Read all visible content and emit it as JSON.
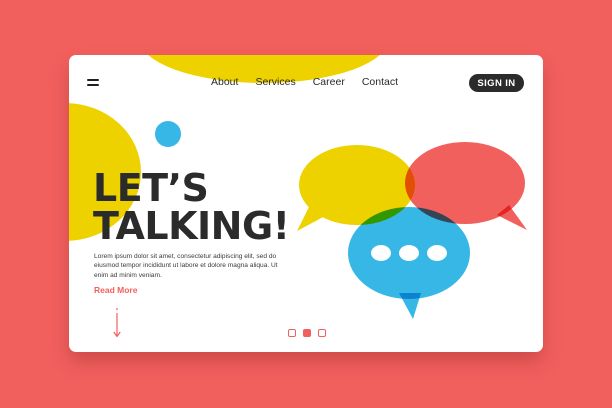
{
  "nav": {
    "items": [
      "About",
      "Services",
      "Career",
      "Contact"
    ],
    "signin_label": "SIGN IN"
  },
  "hero": {
    "headline_line1": "LET’S",
    "headline_line2": "TALKING!",
    "body": "Lorem ipsum dolor sit amet, consectetur adipiscing elit, sed do eiusmod tempor incididunt ut labore et dolore magna aliqua. Ut enim ad minim veniam.",
    "read_more": "Read More"
  },
  "pager": {
    "count": 3,
    "active_index": 1
  },
  "colors": {
    "background": "#F2605E",
    "yellow": "#EED200",
    "red": "#F2605E",
    "blue": "#36B7E6",
    "dark": "#2B2B2B"
  },
  "icons": {
    "menu": "hamburger-icon",
    "scroll": "arrow-down-icon",
    "chat": "speech-bubbles-illustration"
  }
}
